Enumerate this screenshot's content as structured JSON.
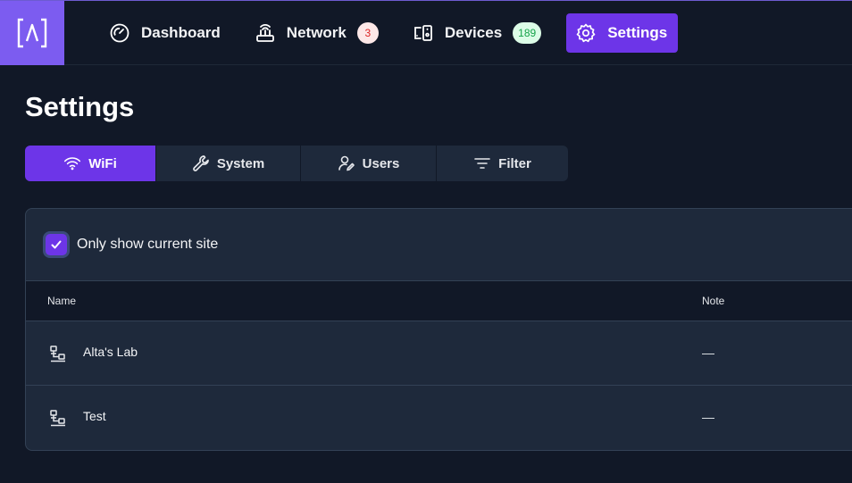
{
  "nav": {
    "items": [
      {
        "label": "Dashboard",
        "icon": "speedometer-icon"
      },
      {
        "label": "Network",
        "icon": "router-icon",
        "badge": "3"
      },
      {
        "label": "Devices",
        "icon": "devices-icon",
        "badge": "189"
      },
      {
        "label": "Settings",
        "icon": "gear-icon",
        "active": true
      }
    ]
  },
  "page": {
    "title": "Settings"
  },
  "tabs": [
    {
      "label": "WiFi",
      "icon": "wifi-icon",
      "active": true
    },
    {
      "label": "System",
      "icon": "wrench-icon"
    },
    {
      "label": "Users",
      "icon": "user-edit-icon"
    },
    {
      "label": "Filter",
      "icon": "filter-icon"
    }
  ],
  "filter": {
    "label": "Only show current site",
    "checked": true
  },
  "table": {
    "columns": [
      "Name",
      "Note"
    ],
    "rows": [
      {
        "name": "Alta's Lab",
        "note": "—"
      },
      {
        "name": "Test",
        "note": "—"
      }
    ]
  },
  "colors": {
    "accent": "#6d35e8",
    "logo_bg": "#7c5cf0",
    "background": "#111827",
    "panel": "#1e293b"
  }
}
